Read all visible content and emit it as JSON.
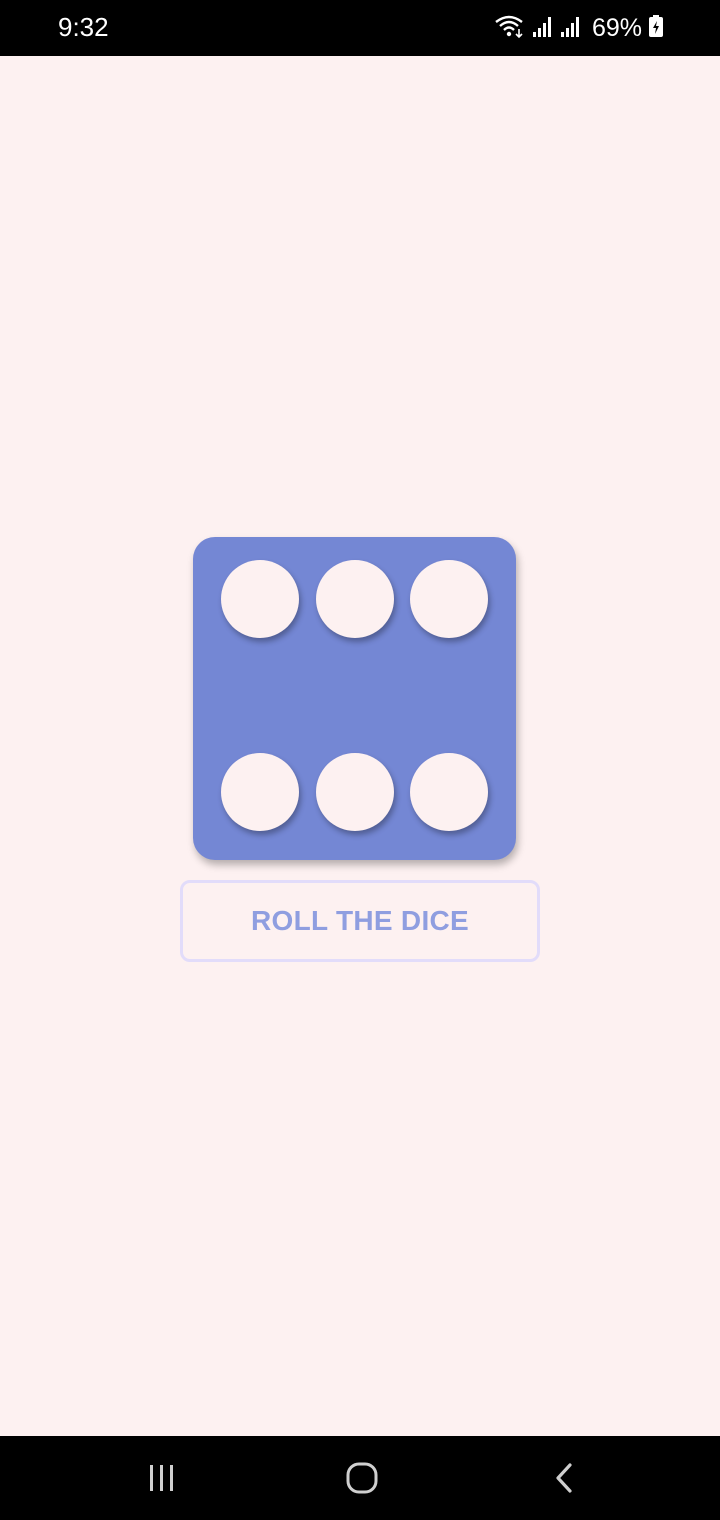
{
  "status_bar": {
    "time": "9:32",
    "battery": "69%",
    "icons": [
      "wifi-icon",
      "signal-icon",
      "signal-icon",
      "battery-charging-icon"
    ]
  },
  "dice": {
    "face_value": 6,
    "color": "#7487d4",
    "pip_color": "#fdf1f1"
  },
  "roll_button": {
    "label": "ROLL THE DICE",
    "text_color": "#8f9ee0",
    "border_color": "#e2dcfa"
  },
  "background_color": "#fdf1f1",
  "nav_bar": {
    "buttons": [
      "recent-apps-icon",
      "home-icon",
      "back-icon"
    ]
  }
}
